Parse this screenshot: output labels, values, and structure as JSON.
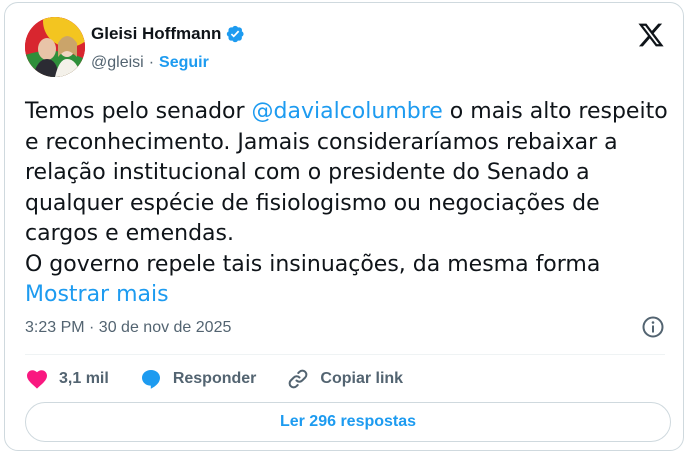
{
  "author": {
    "display_name": "Gleisi Hoffmann",
    "handle": "@gleisi",
    "separator": "·",
    "follow_label": "Seguir"
  },
  "tweet": {
    "line1_before": "Temos pelo senador ",
    "mention": "@davialcolumbre",
    "line1_after": " o mais alto respeito e reconhecimento. Jamais consideraríamos rebaixar a relação institucional com o presidente do Senado a qualquer espécie de fisiologismo ou negociações de cargos e emendas.",
    "line2": "O governo repele tais insinuações, da mesma forma ",
    "show_more": "Mostrar mais"
  },
  "meta": {
    "timestamp": "3:23 PM · 30 de nov de 2025"
  },
  "actions": {
    "likes": "3,1 mil",
    "reply_label": "Responder",
    "copy_label": "Copiar link"
  },
  "replies_button": "Ler 296 respostas",
  "colors": {
    "accent": "#1d9bf0",
    "like": "#f91880",
    "text": "#0f1419",
    "muted": "#536471"
  }
}
